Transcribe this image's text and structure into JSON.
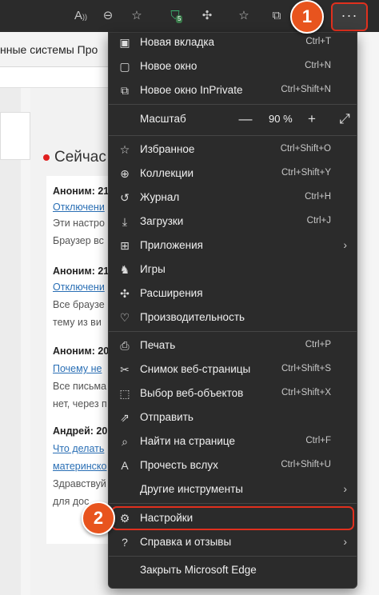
{
  "toolbar": {
    "icons": [
      "read-aloud-icon",
      "zoom-out-icon",
      "add-favorite-icon",
      "shield-icon",
      "extensions-icon",
      "favorites-icon",
      "collections-icon"
    ],
    "shield_badge": "5",
    "more_label": "···"
  },
  "page": {
    "bookmarks_text": "нные системы   Про",
    "section_title": "Сейчас",
    "comments": [
      {
        "author": "Аноним: 21",
        "link": "Отключени",
        "text": [
          "Эти настро",
          "Браузер вс"
        ]
      },
      {
        "author": "Аноним: 21",
        "link": "Отключени",
        "text": [
          "Все браузе",
          "тему из ви"
        ]
      },
      {
        "author": "Аноним: 20",
        "link": "Почему не",
        "text": [
          "Все письма",
          "нет, через п"
        ]
      },
      {
        "author": "Андрей: 20",
        "link": "Что делать",
        "link2": "материнско",
        "text": [
          "Здравствуй",
          "для дос"
        ]
      }
    ]
  },
  "menu": {
    "items": [
      {
        "label": "Новая вкладка",
        "shortcut": "Ctrl+T",
        "icon": "new-tab-icon",
        "glyph": "▣"
      },
      {
        "label": "Новое окно",
        "shortcut": "Ctrl+N",
        "icon": "new-window-icon",
        "glyph": "▢"
      },
      {
        "label": "Новое окно InPrivate",
        "shortcut": "Ctrl+Shift+N",
        "icon": "inprivate-icon",
        "glyph": "⧉"
      },
      {
        "label": "Избранное",
        "shortcut": "Ctrl+Shift+O",
        "icon": "favorites-icon",
        "glyph": "☆"
      },
      {
        "label": "Коллекции",
        "shortcut": "Ctrl+Shift+Y",
        "icon": "collections-icon",
        "glyph": "⊕"
      },
      {
        "label": "Журнал",
        "shortcut": "Ctrl+H",
        "icon": "history-icon",
        "glyph": "↺"
      },
      {
        "label": "Загрузки",
        "shortcut": "Ctrl+J",
        "icon": "download-icon",
        "glyph": "⤓"
      },
      {
        "label": "Приложения",
        "shortcut": "",
        "icon": "apps-icon",
        "glyph": "⊞",
        "submenu": true
      },
      {
        "label": "Игры",
        "shortcut": "",
        "icon": "games-icon",
        "glyph": "♞"
      },
      {
        "label": "Расширения",
        "shortcut": "",
        "icon": "extensions-icon",
        "glyph": "✣"
      },
      {
        "label": "Производительность",
        "shortcut": "",
        "icon": "performance-icon",
        "glyph": "♡"
      },
      {
        "label": "Печать",
        "shortcut": "Ctrl+P",
        "icon": "print-icon",
        "glyph": "⎙"
      },
      {
        "label": "Снимок веб-страницы",
        "shortcut": "Ctrl+Shift+S",
        "icon": "screenshot-icon",
        "glyph": "✂"
      },
      {
        "label": "Выбор веб-объектов",
        "shortcut": "Ctrl+Shift+X",
        "icon": "web-select-icon",
        "glyph": "⬚"
      },
      {
        "label": "Отправить",
        "shortcut": "",
        "icon": "share-icon",
        "glyph": "⇗"
      },
      {
        "label": "Найти на странице",
        "shortcut": "Ctrl+F",
        "icon": "find-icon",
        "glyph": "⌕"
      },
      {
        "label": "Прочесть вслух",
        "shortcut": "Ctrl+Shift+U",
        "icon": "read-aloud-icon",
        "glyph": "A"
      },
      {
        "label": "Другие инструменты",
        "shortcut": "",
        "icon": "more-tools-icon",
        "glyph": "",
        "submenu": true
      },
      {
        "label": "Настройки",
        "shortcut": "",
        "icon": "settings-icon",
        "glyph": "⚙"
      },
      {
        "label": "Справка и отзывы",
        "shortcut": "",
        "icon": "help-icon",
        "glyph": "?",
        "submenu": true
      },
      {
        "label": "Закрыть Microsoft Edge",
        "shortcut": "",
        "icon": "close-edge-icon",
        "glyph": ""
      }
    ],
    "zoom": {
      "label": "Масштаб",
      "value": "90 %",
      "minus": "—",
      "plus": "+",
      "full": "⤢"
    },
    "submenu_glyph": "›"
  },
  "callouts": [
    "1",
    "2"
  ],
  "colors": {
    "menu_bg": "#2b2b2b",
    "highlight": "#e0301e",
    "callout": "#e8541e"
  }
}
